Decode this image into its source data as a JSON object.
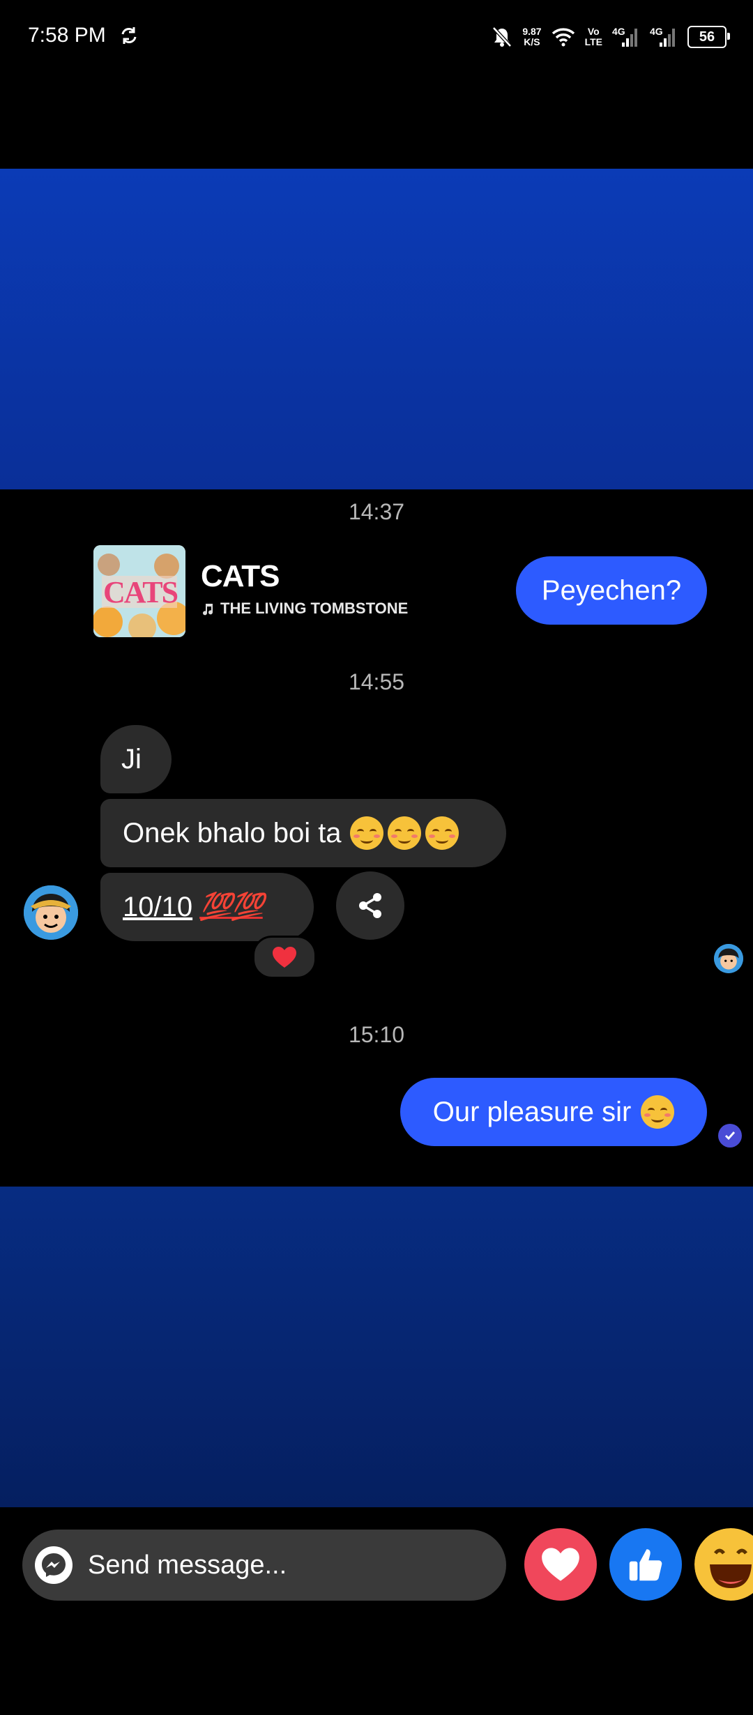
{
  "status_bar": {
    "time": "7:58 PM",
    "speed_value": "9.87",
    "speed_unit": "K/S",
    "volte_top": "Vo",
    "volte_bottom": "LTE",
    "net1": "4G",
    "net2": "4G",
    "battery": "56"
  },
  "chat": {
    "timestamps": [
      "14:37",
      "14:55",
      "15:10"
    ],
    "music_card": {
      "title": "CATS",
      "artist": "THE LIVING TOMBSTONE",
      "art_text": "CATS"
    },
    "messages": {
      "out_1": "Peyechen?",
      "in_1": "Ji",
      "in_2": "Onek bhalo boi ta",
      "in_3": "10/10",
      "in_3_suffix": "💯💯",
      "out_2": "Our pleasure sir"
    },
    "reaction": "heart"
  },
  "composer": {
    "placeholder": "Send message..."
  },
  "colors": {
    "outgoing_bubble": "#2d5bff",
    "incoming_bubble": "#2b2b2b",
    "heart_button": "#f0475b",
    "like_button": "#1877f2"
  }
}
